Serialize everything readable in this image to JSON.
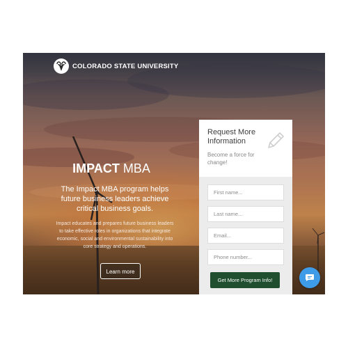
{
  "header": {
    "logo_icon": "ram-head-icon",
    "university": "COLORADO STATE UNIVERSITY"
  },
  "hero": {
    "title_bold": "IMPACT",
    "title_rest": " MBA",
    "tagline": "The Impact MBA program helps future business leaders achieve critical business goals.",
    "description": "Impact educates and prepares future business leaders to take effective roles in organizations that integrate economic, social and environmental sustainability into core strategy and operations.",
    "learn_more_label": "Learn more"
  },
  "form": {
    "title": "Request More Information",
    "subtitle": "Become a force for change!",
    "icon": "pencil-icon",
    "first_name_placeholder": "First name...",
    "last_name_placeholder": "Last name...",
    "email_placeholder": "Email...",
    "phone_placeholder": "Phone number...",
    "submit_label": "Get More Program Info!",
    "submit_color": "#1f4f2f"
  },
  "chat": {
    "icon": "chat-bubble-icon",
    "color": "#3d9be8"
  }
}
